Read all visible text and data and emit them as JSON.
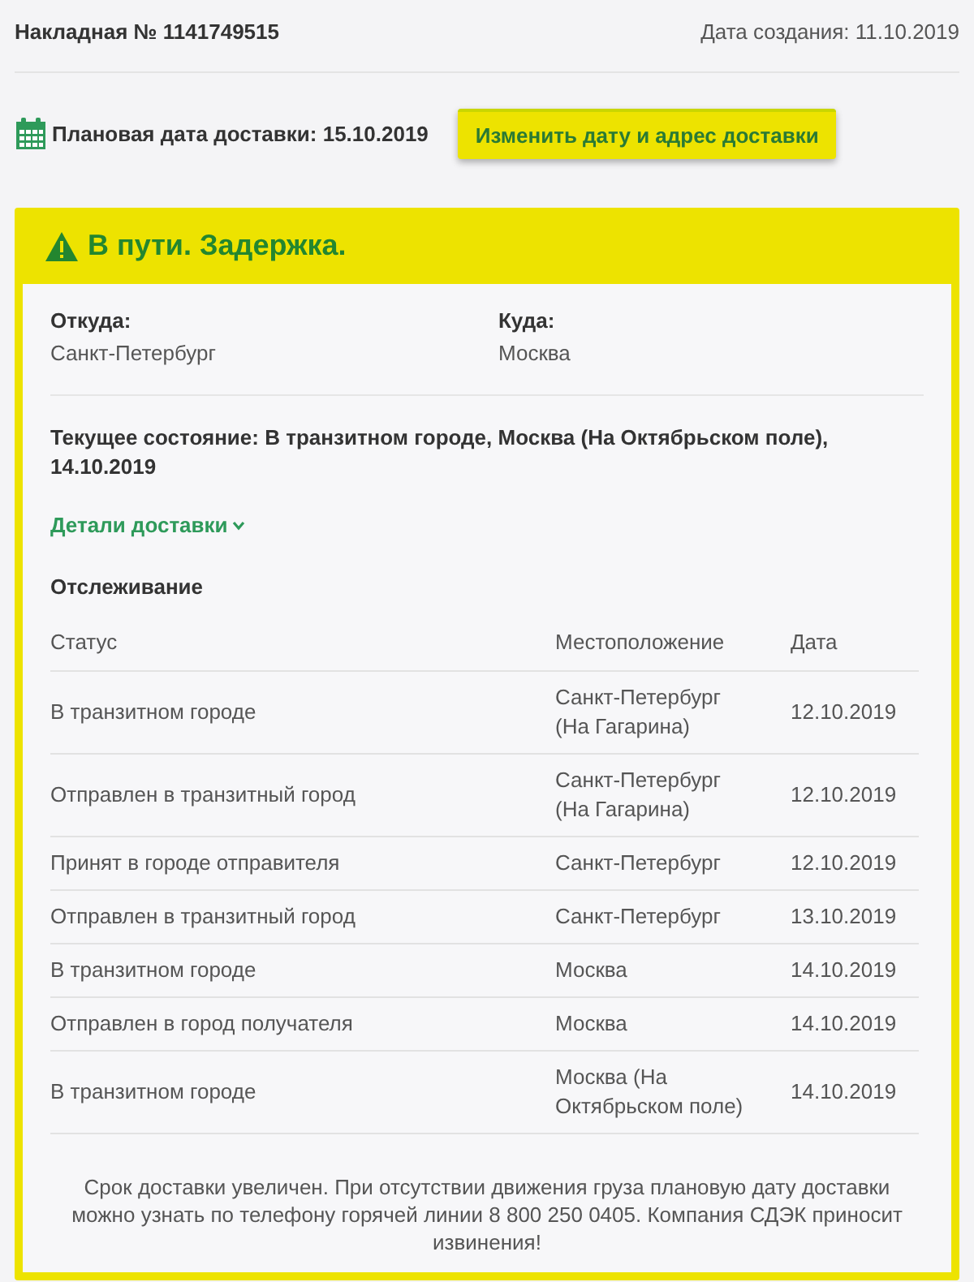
{
  "header": {
    "invoice": "Накладная № 1141749515",
    "created": "Дата создания: 11.10.2019"
  },
  "planned": {
    "text": "Плановая дата доставки: 15.10.2019",
    "button": "Изменить дату и адрес доставки"
  },
  "status": {
    "title": "В пути. Задержка.",
    "from": {
      "label": "Откуда:",
      "value": "Санкт-Петербург"
    },
    "to": {
      "label": "Куда:",
      "value": "Москва"
    },
    "current": "Текущее состояние: В транзитном городе, Москва (На Октябрьском поле), 14.10.2019",
    "details_link": "Детали доставки",
    "tracking": {
      "title": "Отслеживание",
      "columns": [
        "Статус",
        "Местоположение",
        "Дата"
      ],
      "rows": [
        {
          "status": "В транзитном городе",
          "location": "Санкт-Петербург (На Гагарина)",
          "date": "12.10.2019"
        },
        {
          "status": "Отправлен в транзитный город",
          "location": "Санкт-Петербург (На Гагарина)",
          "date": "12.10.2019"
        },
        {
          "status": "Принят в городе отправителя",
          "location": "Санкт-Петербург",
          "date": "12.10.2019"
        },
        {
          "status": "Отправлен в транзитный город",
          "location": "Санкт-Петербург",
          "date": "13.10.2019"
        },
        {
          "status": "В транзитном городе",
          "location": "Москва",
          "date": "14.10.2019"
        },
        {
          "status": "Отправлен в город получателя",
          "location": "Москва",
          "date": "14.10.2019"
        },
        {
          "status": "В транзитном городе",
          "location": "Москва (На Октябрьском поле)",
          "date": "14.10.2019"
        }
      ]
    },
    "note": "Срок доставки увеличен. При отсутствии движения груза плановую дату доставки можно узнать по телефону горячей линии 8 800 250 0405. Компания СДЭК приносит извинения!"
  }
}
